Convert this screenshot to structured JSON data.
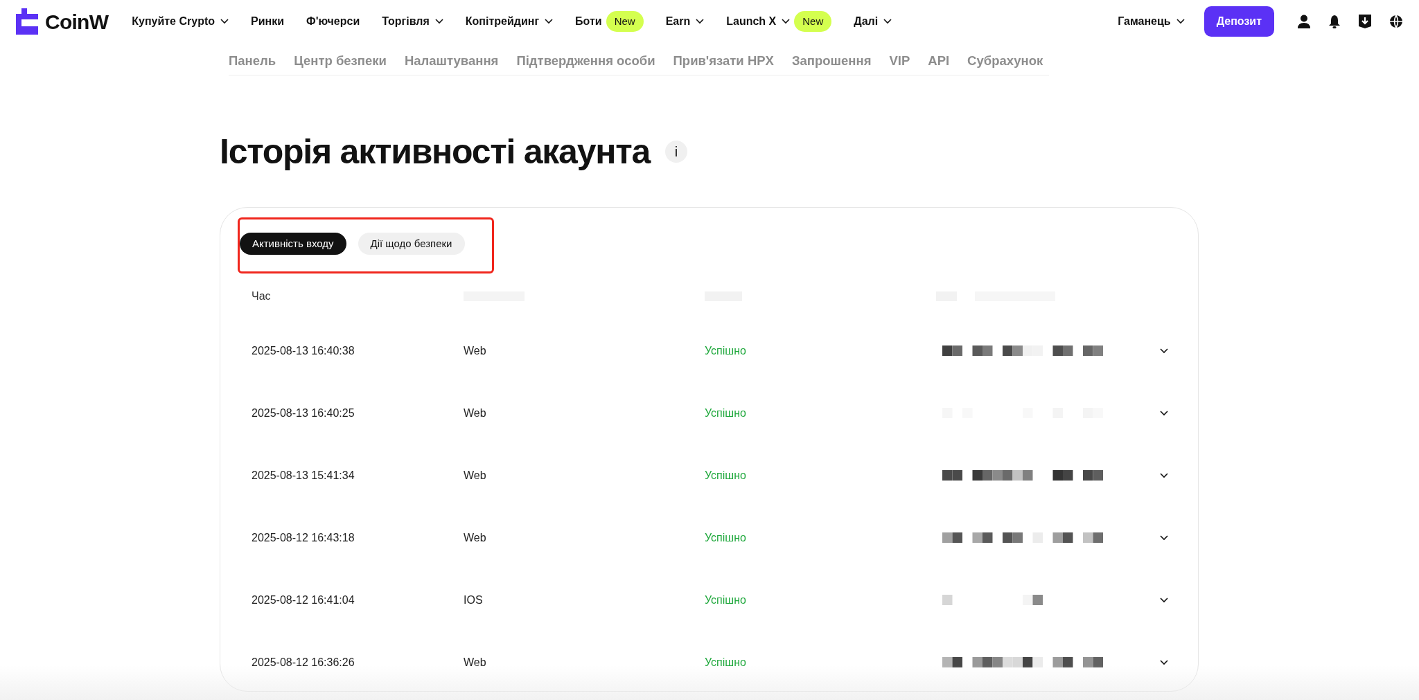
{
  "header": {
    "logo": "CoinW",
    "nav": [
      {
        "label": "Купуйте Crypto",
        "dropdown": true
      },
      {
        "label": "Ринки",
        "dropdown": false
      },
      {
        "label": "Ф'ючерси",
        "dropdown": false
      },
      {
        "label": "Торгівля",
        "dropdown": true
      },
      {
        "label": "Копітрейдинг",
        "dropdown": true
      },
      {
        "label": "Боти",
        "dropdown": false,
        "badge": "New"
      },
      {
        "label": "Earn",
        "dropdown": true
      },
      {
        "label": "Launch X",
        "dropdown": true,
        "badge": "New"
      },
      {
        "label": "Далі",
        "dropdown": true
      }
    ],
    "wallet": "Гаманець",
    "deposit": "Депозит"
  },
  "subnav": [
    "Панель",
    "Центр безпеки",
    "Налаштування",
    "Підтвердження особи",
    "Прив'язати HPX",
    "Запрошення",
    "VIP",
    "API",
    "Субрахунок"
  ],
  "title": "Історія активності акаунта",
  "info_icon": "i",
  "tabs": [
    {
      "label": "Активність входу",
      "selected": true
    },
    {
      "label": "Дії щодо безпеки",
      "selected": false
    }
  ],
  "table": {
    "columns": [
      "Час"
    ],
    "rows": [
      {
        "time": "2025-08-13 16:40:38",
        "device": "Web",
        "status": "Успішно"
      },
      {
        "time": "2025-08-13 16:40:25",
        "device": "Web",
        "status": "Успішно"
      },
      {
        "time": "2025-08-13 15:41:34",
        "device": "Web",
        "status": "Успішно"
      },
      {
        "time": "2025-08-12 16:43:18",
        "device": "Web",
        "status": "Успішно"
      },
      {
        "time": "2025-08-12 16:41:04",
        "device": "IOS",
        "status": "Успішно"
      },
      {
        "time": "2025-08-12 16:36:26",
        "device": "Web",
        "status": "Успішно"
      }
    ]
  }
}
